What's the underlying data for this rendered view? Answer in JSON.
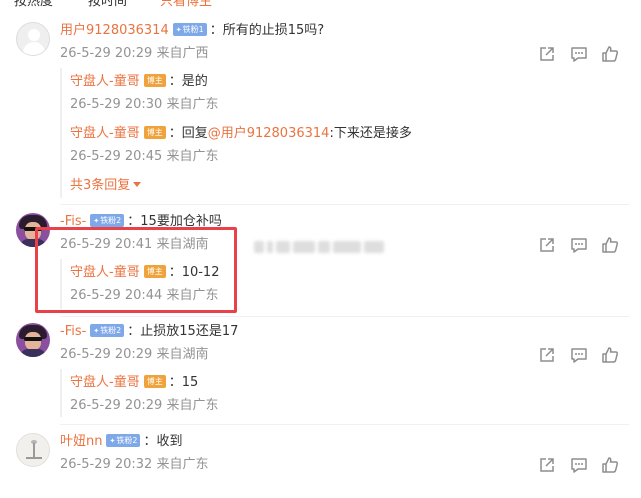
{
  "top_strip": {
    "tabs": [
      "按热度",
      "按时间",
      "只看博主"
    ]
  },
  "badge_symbol": "✦",
  "blogger_badge": "博主",
  "comments": [
    {
      "username": "用户9128036314",
      "badge": "铁粉1",
      "text": "：所有的止损15吗?",
      "meta": "26-5-29 20:29 来自广西",
      "replies": [
        {
          "username": "守盘人-童哥",
          "text": "：是的",
          "meta": "26-5-29 20:30 来自广东"
        },
        {
          "username": "守盘人-童哥",
          "reply_prefix": "：回复",
          "mention": "@用户9128036314",
          "text": ":下来还是接多",
          "meta": "26-5-29 20:45 来自广东"
        }
      ],
      "more_replies": "共3条回复"
    },
    {
      "username": "-Fis-",
      "badge": "铁粉2",
      "text": "：15要加仓补吗",
      "meta": "26-5-29 20:41 来自湖南",
      "replies": [
        {
          "username": "守盘人-童哥",
          "text": "：10-12",
          "meta": "26-5-29 20:44 来自广东"
        }
      ]
    },
    {
      "username": "-Fis-",
      "badge": "铁粉2",
      "text": "：止损放15还是17",
      "meta": "26-5-29 20:29 来自湖南",
      "replies": [
        {
          "username": "守盘人-童哥",
          "text": "：15",
          "meta": "26-5-29 20:29 来自广东"
        }
      ]
    },
    {
      "username": "叶妞nn",
      "badge": "铁粉2",
      "text": "：收到",
      "meta": "26-5-29 20:32 来自广东",
      "replies": []
    }
  ],
  "actions": {
    "share": "share-icon",
    "comment": "comment-icon",
    "like": "like-icon"
  },
  "colors": {
    "username": "#eb7340",
    "meta": "#939393",
    "badge": "#7fa8e8",
    "blogger": "#f0a33c",
    "highlight": "#e8414a",
    "icon": "#8d8d8d"
  }
}
